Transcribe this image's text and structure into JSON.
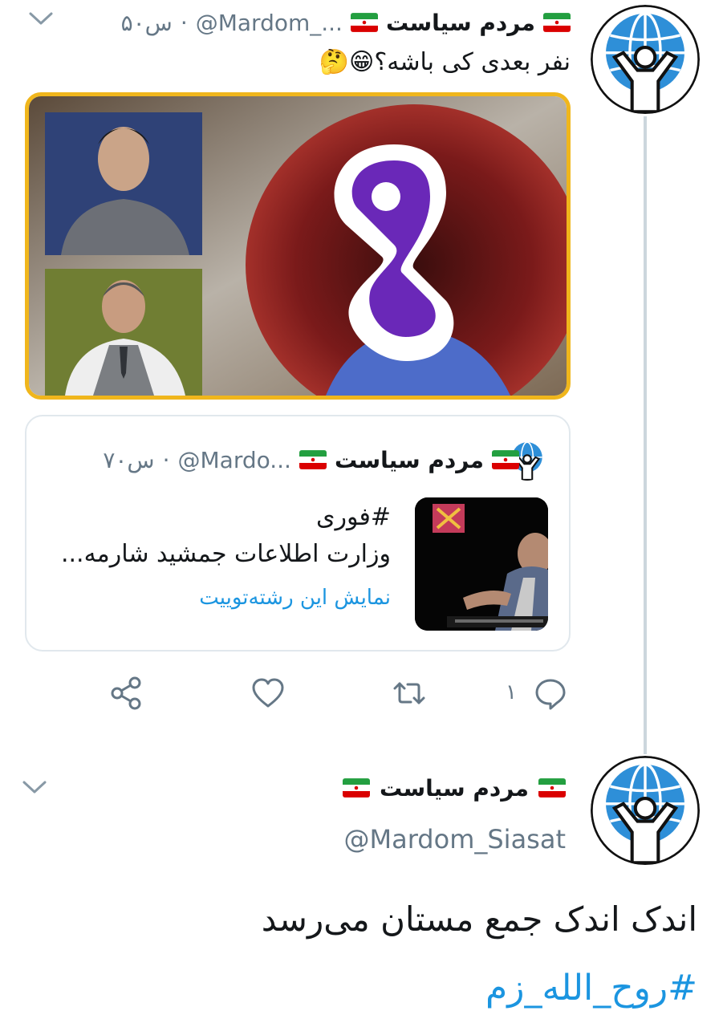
{
  "tweet1": {
    "display_name": "مردم سیاست",
    "handle": "@Mardom_...",
    "time": "۵۰س",
    "separator": "·",
    "text": "نفر بعدی کی باشه؟😁🤔"
  },
  "quote": {
    "display_name": "مردم سیاست",
    "handle": "@Mardo...",
    "time": "۷۰س",
    "separator": "·",
    "hashtag": "#فوری",
    "text": "وزارت اطلاعات جمشید شارمه...",
    "thread_link": "نمایش این رشته‌توییت"
  },
  "actions": {
    "reply_count": "۱",
    "icons": [
      "reply-icon",
      "retweet-icon",
      "like-icon",
      "share-icon"
    ]
  },
  "tweet2": {
    "display_name": "مردم سیاست",
    "handle": "@Mardom_Siasat",
    "text": "اندک اندک جمع مستان می‌رسد",
    "hashtag": "#روح_الله_زم"
  },
  "colors": {
    "link": "#1b95e0",
    "muted": "#657786",
    "media_border": "#f0b61c",
    "avatar_blue": "#2e8fd8"
  }
}
